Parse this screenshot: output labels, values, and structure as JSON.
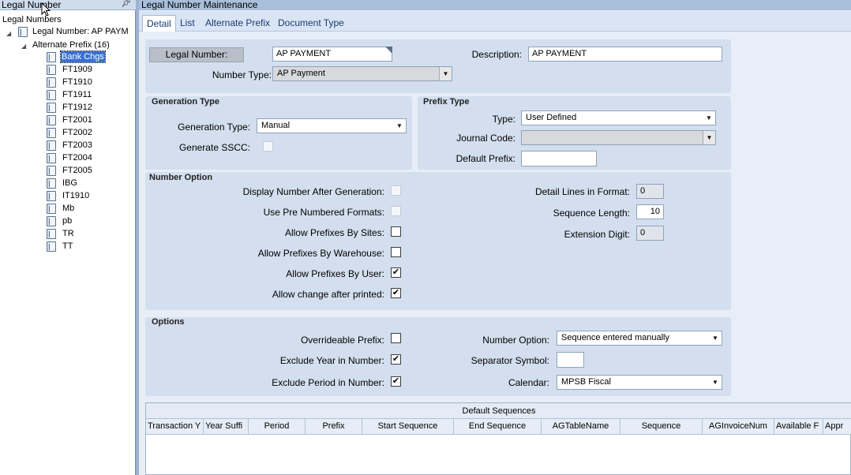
{
  "left_panel": {
    "title": "Legal Number",
    "tree": {
      "root": "Legal Numbers",
      "legal_number": "Legal Number: AP PAYM",
      "alternate_prefix": "Alternate Prefix (16)",
      "items": [
        "Bank Chgs",
        "FT1909",
        "FT1910",
        "FT1911",
        "FT1912",
        "FT2001",
        "FT2002",
        "FT2003",
        "FT2004",
        "FT2005",
        "IBG",
        "IT1910",
        "Mb",
        "pb",
        "TR",
        "TT"
      ]
    }
  },
  "main": {
    "title": "Legal Number Maintenance",
    "tabs": [
      "Detail",
      "List",
      "Alternate Prefix",
      "Document Type"
    ],
    "header": {
      "legal_number_label": "Legal Number:",
      "legal_number_value": "AP PAYMENT",
      "description_label": "Description:",
      "description_value": "AP PAYMENT",
      "number_type_label": "Number Type:",
      "number_type_value": "AP Payment"
    },
    "generation_type": {
      "title": "Generation Type",
      "type_label": "Generation Type:",
      "type_value": "Manual",
      "sscc_label": "Generate SSCC:"
    },
    "prefix_type": {
      "title": "Prefix Type",
      "type_label": "Type:",
      "type_value": "User Defined",
      "journal_label": "Journal Code:",
      "journal_value": "",
      "default_prefix_label": "Default Prefix:",
      "default_prefix_value": ""
    },
    "number_option": {
      "title": "Number Option",
      "display_after_gen": "Display Number After Generation:",
      "use_pre_numbered": "Use Pre Numbered Formats:",
      "by_sites": "Allow Prefixes By Sites:",
      "by_warehouse": "Allow Prefixes By Warehouse:",
      "by_user": "Allow Prefixes By User:",
      "change_after_printed": "Allow change after printed:",
      "detail_lines_label": "Detail Lines in Format:",
      "detail_lines_value": "0",
      "sequence_length_label": "Sequence Length:",
      "sequence_length_value": "10",
      "extension_digit_label": "Extension Digit:",
      "extension_digit_value": "0",
      "check_mark": "✔"
    },
    "options": {
      "title": "Options",
      "overrideable_prefix": "Overrideable Prefix:",
      "exclude_year": "Exclude Year in Number:",
      "exclude_period": "Exclude Period in Number:",
      "number_option_label": "Number Option:",
      "number_option_value": "Sequence entered manually",
      "separator_label": "Separator Symbol:",
      "separator_value": "",
      "calendar_label": "Calendar:",
      "calendar_value": "MPSB Fiscal"
    },
    "grid": {
      "title": "Default Sequences",
      "columns": [
        "Transaction Y",
        "Year Suffi",
        "Period",
        "Prefix",
        "Start Sequence",
        "End Sequence",
        "AGTableName",
        "Sequence",
        "AGInvoiceNum",
        "Available F",
        "Appr"
      ]
    }
  }
}
